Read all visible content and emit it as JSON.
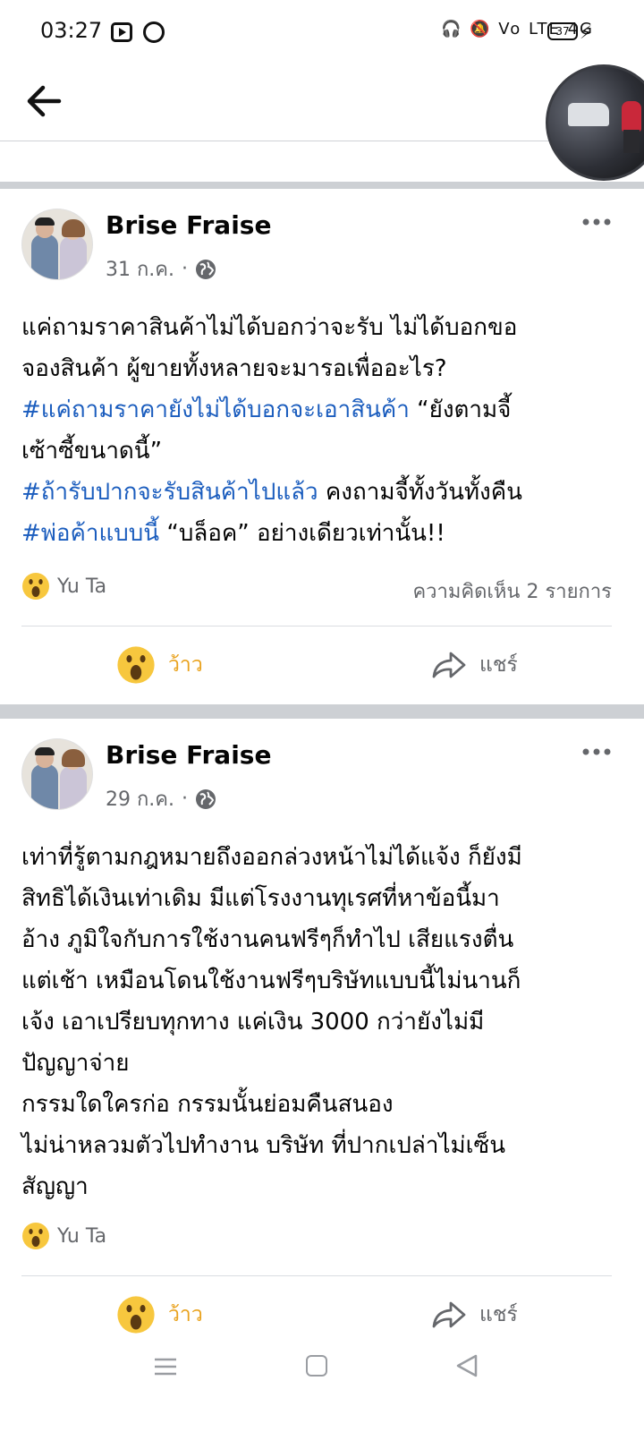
{
  "status_bar": {
    "time": "03:27",
    "right_indicators": "🎧  🔕  Vo LTE  4G",
    "battery": "37"
  },
  "header": {
    "back_label": "back"
  },
  "posts": [
    {
      "author": "Brise Fraise",
      "date": "31 ก.ค.",
      "text_lines": [
        {
          "parts": [
            {
              "t": "แค่ถามราคาสินค้าไม่ได้บอกว่าจะรับ ไม่ได้บอกขอ",
              "tag": false
            }
          ]
        },
        {
          "parts": [
            {
              "t": "จองสินค้า ผู้ขายทั้งหลายจะมารอเพื่ออะไร?",
              "tag": false
            }
          ]
        },
        {
          "parts": [
            {
              "t": "#แค่ถามราคายังไม่ได้บอกจะเอาสินค้า",
              "tag": true
            },
            {
              "t": " “ยังตามจี้",
              "tag": false
            }
          ]
        },
        {
          "parts": [
            {
              "t": "เซ้าซี้ขนาดนี้”",
              "tag": false
            }
          ]
        },
        {
          "parts": [
            {
              "t": "#ถ้ารับปากจะรับสินค้าไปแล้ว",
              "tag": true
            },
            {
              "t": " คงถามจี้ทั้งวันทั้งคืน",
              "tag": false
            }
          ]
        },
        {
          "parts": [
            {
              "t": "#พ่อค้าแบบนี้",
              "tag": true
            },
            {
              "t": " “บล็อค” อย่างเดียวเท่านั้น!!",
              "tag": false
            }
          ]
        }
      ],
      "reactor": "Yu Ta",
      "comments": "ความคิดเห็น 2 รายการ",
      "reaction_label": "ว้าว",
      "share_label": "แชร์"
    },
    {
      "author": "Brise Fraise",
      "date": "29 ก.ค.",
      "text_lines": [
        {
          "parts": [
            {
              "t": "เท่าที่รู้ตามกฎหมายถึงออกล่วงหน้าไม่ได้แจ้ง ก็ยังมี",
              "tag": false
            }
          ]
        },
        {
          "parts": [
            {
              "t": "สิทธิได้เงินเท่าเดิม มีแต่โรงงานทุเรศที่หาข้อนี้มา",
              "tag": false
            }
          ]
        },
        {
          "parts": [
            {
              "t": "อ้าง ภูมิใจกับการใช้งานคนฟรีๆก็ทำไป เสียแรงตื่น",
              "tag": false
            }
          ]
        },
        {
          "parts": [
            {
              "t": "แต่เช้า เหมือนโดนใช้งานฟรีๆบริษัทแบบนี้ไม่นานก็",
              "tag": false
            }
          ]
        },
        {
          "parts": [
            {
              "t": "เจ้ง เอาเปรียบทุกทาง แค่เงิน 3000 กว่ายังไม่มี",
              "tag": false
            }
          ]
        },
        {
          "parts": [
            {
              "t": "ปัญญาจ่าย",
              "tag": false
            }
          ]
        },
        {
          "parts": [
            {
              "t": "กรรมใดใครก่อ กรรมนั้นย่อมคืนสนอง",
              "tag": false
            }
          ]
        },
        {
          "parts": [
            {
              "t": "ไม่น่าหลวมตัวไปทำงาน บริษัท ที่ปากเปล่าไม่เซ็น",
              "tag": false
            }
          ]
        },
        {
          "parts": [
            {
              "t": "สัญญา",
              "tag": false
            }
          ]
        }
      ],
      "reactor": "Yu Ta",
      "comments": "",
      "reaction_label": "ว้าว",
      "share_label": "แชร์"
    }
  ]
}
